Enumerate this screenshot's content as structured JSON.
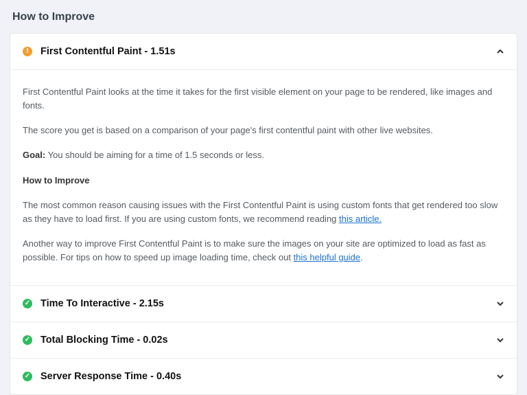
{
  "page_title": "How to Improve",
  "items": [
    {
      "status": "warn",
      "expanded": true,
      "title": "First Contentful Paint - 1.51s",
      "body": {
        "intro1": "First Contentful Paint looks at the time it takes for the first visible element on your page to be rendered, like images and fonts.",
        "intro2": "The score you get is based on a comparison of your page's first contentful paint with other live websites.",
        "goal_label": "Goal:",
        "goal_text": " You should be aiming for a time of 1.5 seconds or less.",
        "sub_heading": "How to Improve",
        "p1_a": "The most common reason causing issues with the First Contentful Paint is using custom fonts that get rendered too slow as they have to load first. If you are using custom fonts, we recommend reading ",
        "p1_link": "this article.",
        "p2_a": "Another way to improve First Contentful Paint is to make sure the images on your site are optimized to load as fast as possible. For tips on how to speed up image loading time, check out ",
        "p2_link": "this helpful guide",
        "p2_b": "."
      }
    },
    {
      "status": "ok",
      "expanded": false,
      "title": "Time To Interactive - 2.15s"
    },
    {
      "status": "ok",
      "expanded": false,
      "title": "Total Blocking Time - 0.02s"
    },
    {
      "status": "ok",
      "expanded": false,
      "title": "Server Response Time - 0.40s"
    }
  ]
}
